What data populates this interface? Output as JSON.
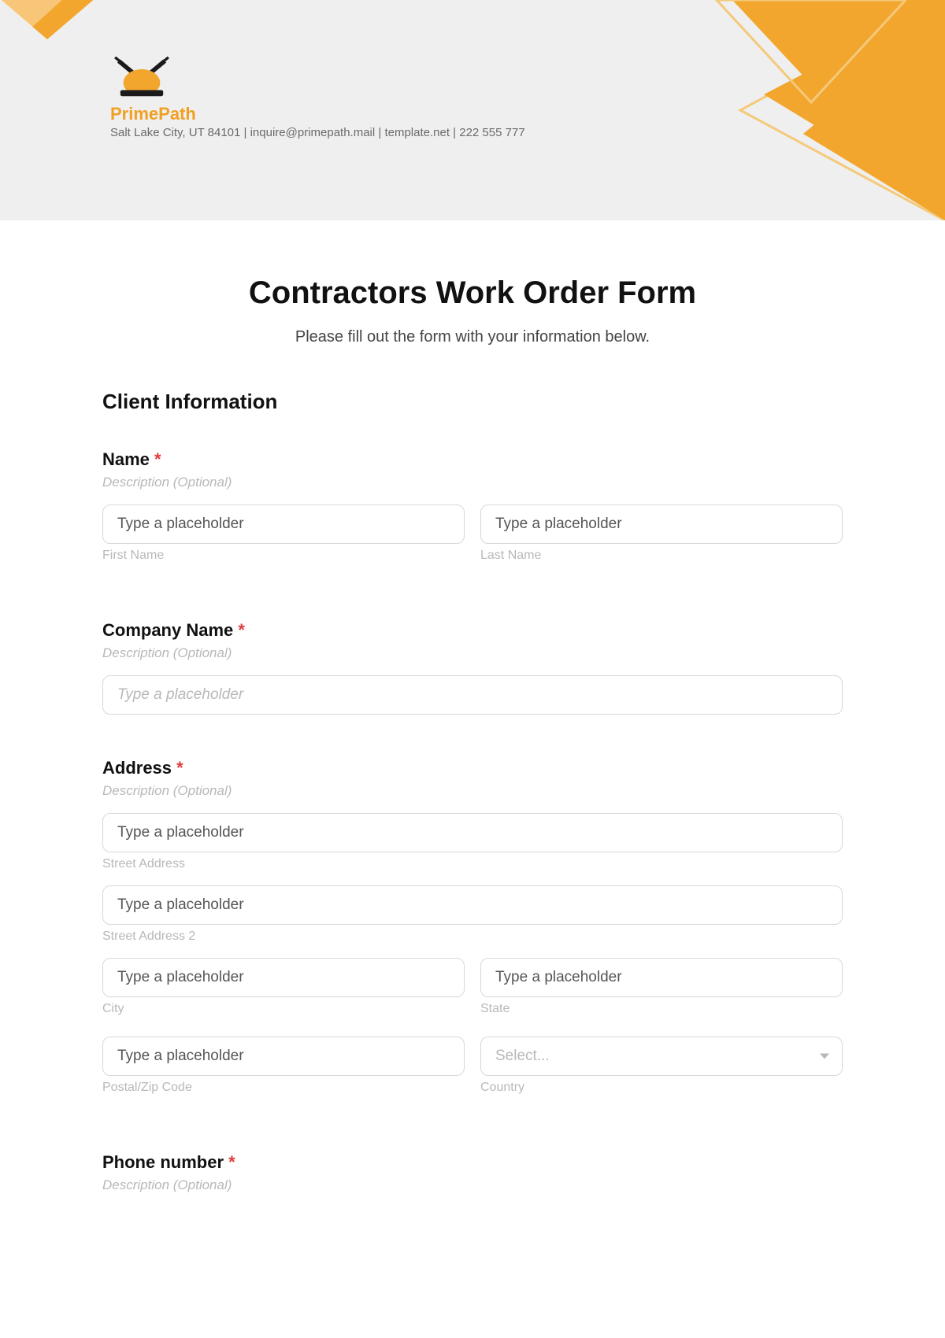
{
  "brand": {
    "name": "PrimePath",
    "address_line": "Salt Lake City, UT 84101 | inquire@primepath.mail | template.net | 222 555 777"
  },
  "form": {
    "title": "Contractors Work Order Form",
    "subtitle": "Please fill out the form with your information below."
  },
  "section": {
    "client_info": "Client Information"
  },
  "fields": {
    "name": {
      "label": "Name",
      "required": "*",
      "description": "Description (Optional)",
      "first_placeholder": "Type a placeholder",
      "last_placeholder": "Type a placeholder",
      "first_sublabel": "First Name",
      "last_sublabel": "Last Name"
    },
    "company": {
      "label": "Company Name",
      "required": "*",
      "description": "Description (Optional)",
      "placeholder": "Type a placeholder"
    },
    "address": {
      "label": "Address",
      "required": "*",
      "description": "Description (Optional)",
      "street1_placeholder": "Type a placeholder",
      "street1_sublabel": "Street Address",
      "street2_placeholder": "Type a placeholder",
      "street2_sublabel": "Street Address 2",
      "city_placeholder": "Type a placeholder",
      "city_sublabel": "City",
      "state_placeholder": "Type a placeholder",
      "state_sublabel": "State",
      "postal_placeholder": "Type a placeholder",
      "postal_sublabel": "Postal/Zip Code",
      "country_placeholder": "Select...",
      "country_sublabel": "Country"
    },
    "phone": {
      "label": "Phone number",
      "required": "*",
      "description": "Description (Optional)"
    }
  }
}
